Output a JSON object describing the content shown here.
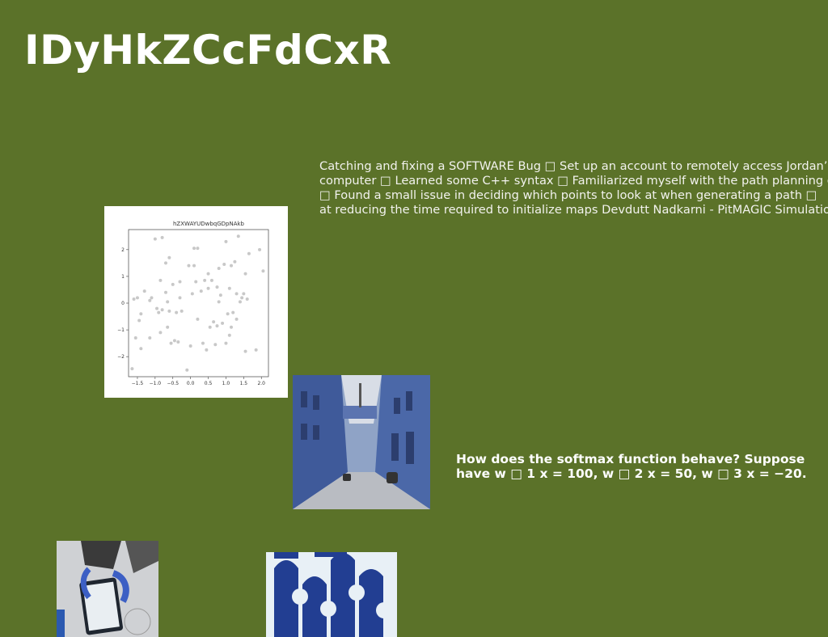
{
  "page": {
    "title": "IDyHkZCcFdCxR",
    "background": "#5b7229"
  },
  "paragraph_lines": [
    "Catching and fixing a SOFTWARE Bug □ Set up an account to remotely access Jordan’s",
    "computer □ Learned some C++ syntax □ Familiarized myself with the path planning code",
    "□ Found a small issue in deciding which points to look at when generating a path □",
    "at reducing the time required to initialize maps Devdutt Nadkarni - PitMAGIC Simulation"
  ],
  "question_lines": [
    "How does the softmax function behave? Suppose",
    "have w □ 1 x = 100, w □ 2 x = 50, w □ 3 x = −20."
  ],
  "chart_data": {
    "type": "scatter",
    "title": "hZXWAYUDwbqGDpNAkb",
    "xlabel": "",
    "ylabel": "",
    "xlim": [
      -1.75,
      2.2
    ],
    "ylim": [
      -2.75,
      2.75
    ],
    "xticks": [
      "−1.5",
      "−1.0",
      "−0.5",
      "0.0",
      "0.5",
      "1.0",
      "1.5",
      "2.0"
    ],
    "yticks": [
      "2",
      "1",
      "0",
      "−1",
      "−2"
    ],
    "grid": false,
    "point_color": "#c8c8c8",
    "points": [
      [
        -1.65,
        -2.45
      ],
      [
        -1.6,
        0.15
      ],
      [
        -1.55,
        -1.3
      ],
      [
        -1.5,
        0.2
      ],
      [
        -1.45,
        -0.65
      ],
      [
        -1.4,
        -1.7
      ],
      [
        -1.4,
        -0.4
      ],
      [
        -1.3,
        0.45
      ],
      [
        -1.15,
        -1.3
      ],
      [
        -1.15,
        0.1
      ],
      [
        -1.1,
        0.2
      ],
      [
        -1.0,
        2.4
      ],
      [
        -0.95,
        -0.2
      ],
      [
        -0.9,
        -0.35
      ],
      [
        -0.85,
        -1.1
      ],
      [
        -0.85,
        0.85
      ],
      [
        -0.8,
        2.45
      ],
      [
        -0.8,
        -0.25
      ],
      [
        -0.7,
        0.4
      ],
      [
        -0.7,
        1.5
      ],
      [
        -0.65,
        -0.9
      ],
      [
        -0.65,
        0.05
      ],
      [
        -0.6,
        -0.3
      ],
      [
        -0.6,
        1.7
      ],
      [
        -0.55,
        -1.5
      ],
      [
        -0.5,
        0.7
      ],
      [
        -0.45,
        -1.4
      ],
      [
        -0.4,
        -0.35
      ],
      [
        -0.35,
        -1.45
      ],
      [
        -0.3,
        0.2
      ],
      [
        -0.3,
        0.8
      ],
      [
        -0.25,
        -0.3
      ],
      [
        -0.1,
        -2.5
      ],
      [
        -0.05,
        1.4
      ],
      [
        0.0,
        -1.6
      ],
      [
        0.05,
        0.35
      ],
      [
        0.1,
        2.05
      ],
      [
        0.1,
        1.4
      ],
      [
        0.15,
        0.8
      ],
      [
        0.2,
        -0.6
      ],
      [
        0.2,
        2.05
      ],
      [
        0.3,
        0.45
      ],
      [
        0.35,
        -1.5
      ],
      [
        0.4,
        0.85
      ],
      [
        0.45,
        -1.75
      ],
      [
        0.5,
        0.55
      ],
      [
        0.5,
        1.1
      ],
      [
        0.55,
        -0.9
      ],
      [
        0.6,
        0.85
      ],
      [
        0.65,
        -0.7
      ],
      [
        0.7,
        -1.55
      ],
      [
        0.75,
        0.6
      ],
      [
        0.75,
        -0.85
      ],
      [
        0.8,
        0.05
      ],
      [
        0.8,
        1.3
      ],
      [
        0.85,
        0.3
      ],
      [
        0.9,
        -0.75
      ],
      [
        0.95,
        1.45
      ],
      [
        1.0,
        -1.5
      ],
      [
        1.0,
        2.3
      ],
      [
        1.05,
        -0.4
      ],
      [
        1.1,
        0.55
      ],
      [
        1.1,
        -1.2
      ],
      [
        1.15,
        1.4
      ],
      [
        1.15,
        -0.9
      ],
      [
        1.2,
        -0.35
      ],
      [
        1.25,
        1.55
      ],
      [
        1.3,
        -0.6
      ],
      [
        1.3,
        0.35
      ],
      [
        1.35,
        2.5
      ],
      [
        1.4,
        0.05
      ],
      [
        1.45,
        0.2
      ],
      [
        1.5,
        0.35
      ],
      [
        1.55,
        1.1
      ],
      [
        1.55,
        -1.8
      ],
      [
        1.6,
        0.15
      ],
      [
        1.65,
        1.85
      ],
      [
        1.85,
        -1.75
      ],
      [
        1.95,
        2.0
      ],
      [
        2.05,
        1.2
      ]
    ]
  }
}
